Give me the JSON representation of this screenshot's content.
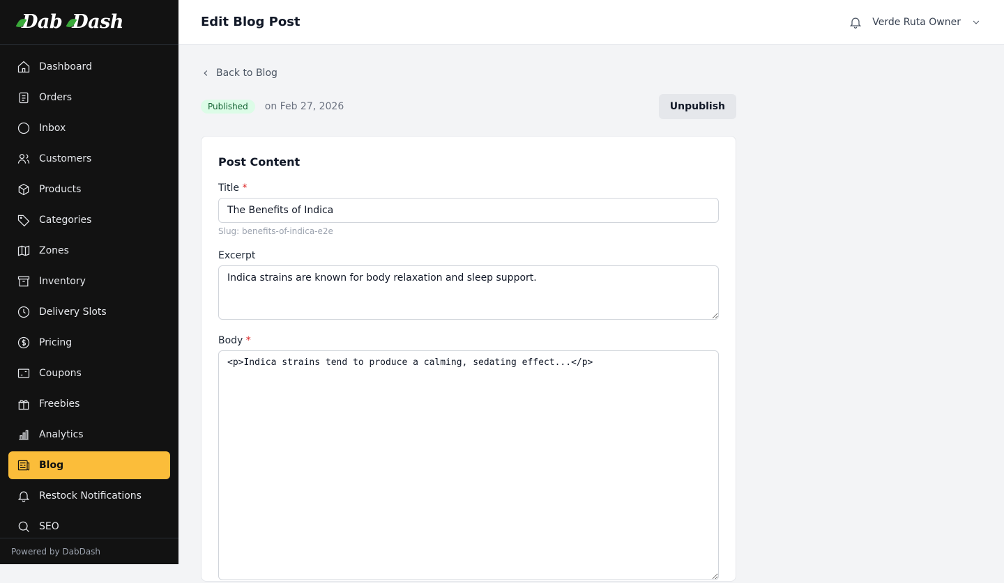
{
  "logo": "DabDash",
  "logo_parts": [
    "Dab",
    "Dash"
  ],
  "sidebar": {
    "items": [
      {
        "label": "Dashboard",
        "icon": "home-icon"
      },
      {
        "label": "Orders",
        "icon": "clipboard-icon"
      },
      {
        "label": "Inbox",
        "icon": "chat-icon"
      },
      {
        "label": "Customers",
        "icon": "users-icon"
      },
      {
        "label": "Products",
        "icon": "cube-icon"
      },
      {
        "label": "Categories",
        "icon": "tag-icon"
      },
      {
        "label": "Zones",
        "icon": "map-icon"
      },
      {
        "label": "Inventory",
        "icon": "archive-icon"
      },
      {
        "label": "Delivery Slots",
        "icon": "clock-icon"
      },
      {
        "label": "Pricing",
        "icon": "dollar-icon"
      },
      {
        "label": "Coupons",
        "icon": "ticket-icon"
      },
      {
        "label": "Freebies",
        "icon": "gift-icon"
      },
      {
        "label": "Analytics",
        "icon": "chart-icon"
      },
      {
        "label": "Blog",
        "icon": "newspaper-icon",
        "active": true
      },
      {
        "label": "Restock Notifications",
        "icon": "bell-icon"
      },
      {
        "label": "SEO",
        "icon": "search-icon"
      }
    ],
    "footer": "Powered by DabDash"
  },
  "header": {
    "title": "Edit Blog Post",
    "user": "Verde Ruta Owner"
  },
  "main": {
    "back": "Back to Blog",
    "status": "Published",
    "date": "on Feb 27, 2026",
    "unpublish": "Unpublish",
    "card_title": "Post Content",
    "title_label": "Title",
    "title_value": "The Benefits of Indica",
    "slug": "Slug: benefits-of-indica-e2e",
    "excerpt_label": "Excerpt",
    "excerpt_value": "Indica strains are known for body relaxation and sleep support.",
    "body_label": "Body",
    "body_value": "<p>Indica strains tend to produce a calming, sedating effect...</p>",
    "required": "*"
  },
  "colors": {
    "accent": "#fbbd3a",
    "sidebar": "#121212",
    "badge_bg": "#dcfce7"
  }
}
